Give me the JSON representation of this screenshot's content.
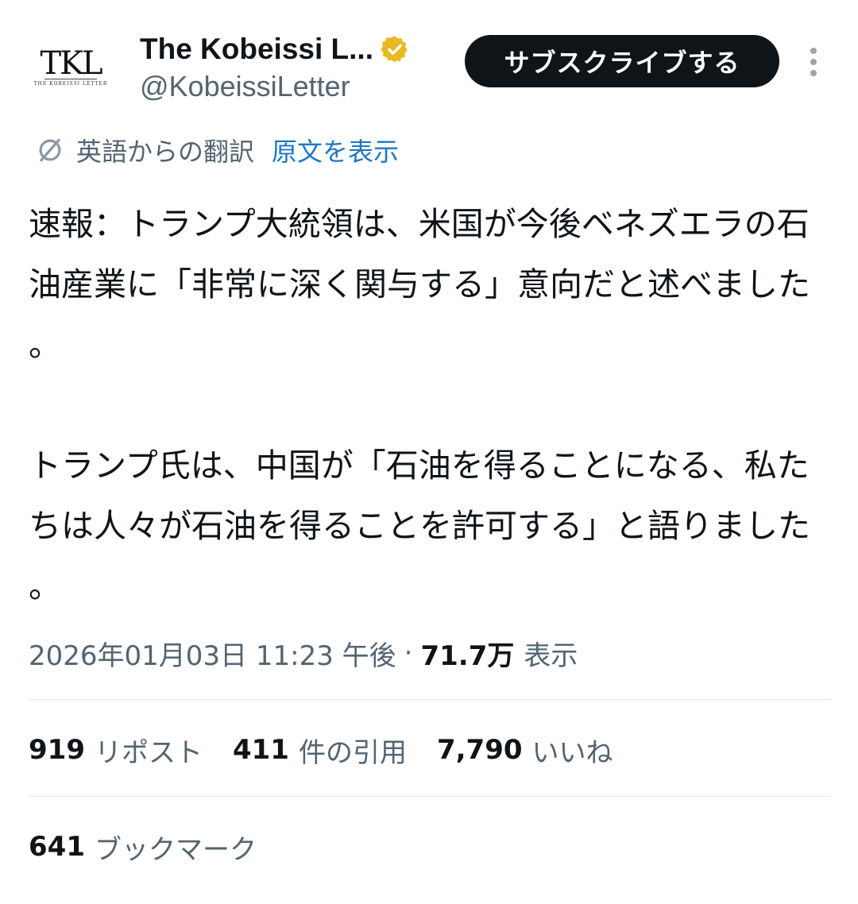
{
  "account": {
    "avatar_logo_text": "TKL",
    "avatar_logo_subtext": "THE KOBEISSI LETTER",
    "display_name": "The Kobeissi L...",
    "handle": "@KobeissiLetter",
    "verified_badge_color": "#e8b923",
    "subscribe_label": "サブスクライブする"
  },
  "translation": {
    "label": "英語からの翻訳",
    "show_original": "原文を表示"
  },
  "tweet": {
    "paragraph_1": "速報：トランプ大統領は、米国が今後ベネズエラの石油産業に「非常に深く関与する」意向だと述べました。",
    "paragraph_2": "トランプ氏は、中国が「石油を得ることになる、私たちは人々が石油を得ることを許可する」と語りました。"
  },
  "meta": {
    "datetime": "2026年01月03日 11:23 午後",
    "separator": "·",
    "views_count": "71.7万",
    "views_label": "表示"
  },
  "stats": {
    "reposts": {
      "count": "919",
      "label": "リポスト"
    },
    "quotes": {
      "count": "411",
      "label": "件の引用"
    },
    "likes": {
      "count": "7,790",
      "label": "いいね"
    },
    "bookmarks": {
      "count": "641",
      "label": "ブックマーク"
    }
  },
  "colors": {
    "text_primary": "#0f1419",
    "text_secondary": "#536471",
    "link": "#1d77c2",
    "button_bg": "#0f1419",
    "divider": "#e6ebee"
  },
  "icons": {
    "more": "more-vertical-icon",
    "translate": "translate-icon",
    "verified": "verified-badge-icon"
  }
}
